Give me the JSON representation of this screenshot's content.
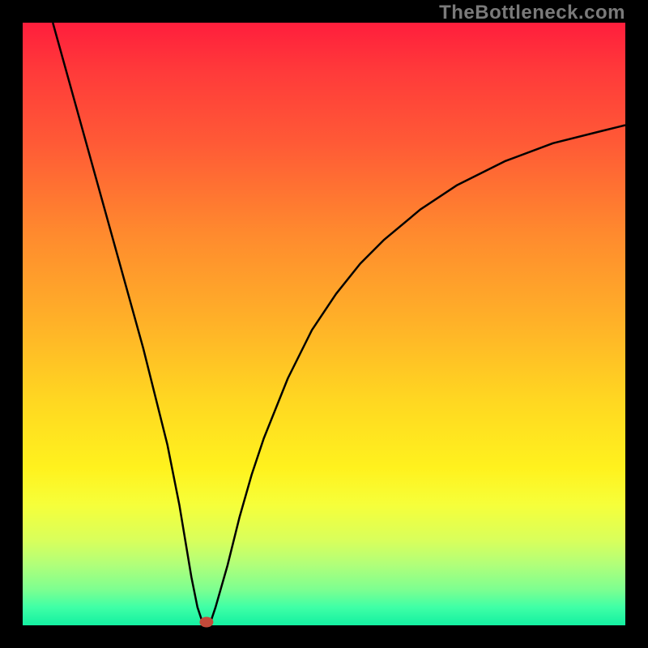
{
  "watermark": "TheBottleneck.com",
  "chart_data": {
    "type": "line",
    "title": "",
    "xlabel": "",
    "ylabel": "",
    "xlim": [
      0,
      100
    ],
    "ylim": [
      0,
      100
    ],
    "background_gradient": [
      "#ff1e3c",
      "#ff8a2e",
      "#ffd821",
      "#fff21e",
      "#14f0a1"
    ],
    "series": [
      {
        "name": "bottleneck-curve",
        "x": [
          5,
          10,
          15,
          20,
          22,
          24,
          26,
          28,
          29,
          30,
          31,
          32,
          34,
          36,
          38,
          40,
          44,
          48,
          52,
          56,
          60,
          66,
          72,
          80,
          88,
          96,
          100
        ],
        "values": [
          100,
          82,
          64,
          46,
          38,
          30,
          20,
          8,
          3,
          0,
          0,
          3,
          10,
          18,
          25,
          31,
          41,
          49,
          55,
          60,
          64,
          69,
          73,
          77,
          80,
          82,
          83
        ]
      }
    ],
    "annotations": [
      {
        "name": "optimal-point",
        "x": 30.5,
        "y": 0
      }
    ]
  }
}
